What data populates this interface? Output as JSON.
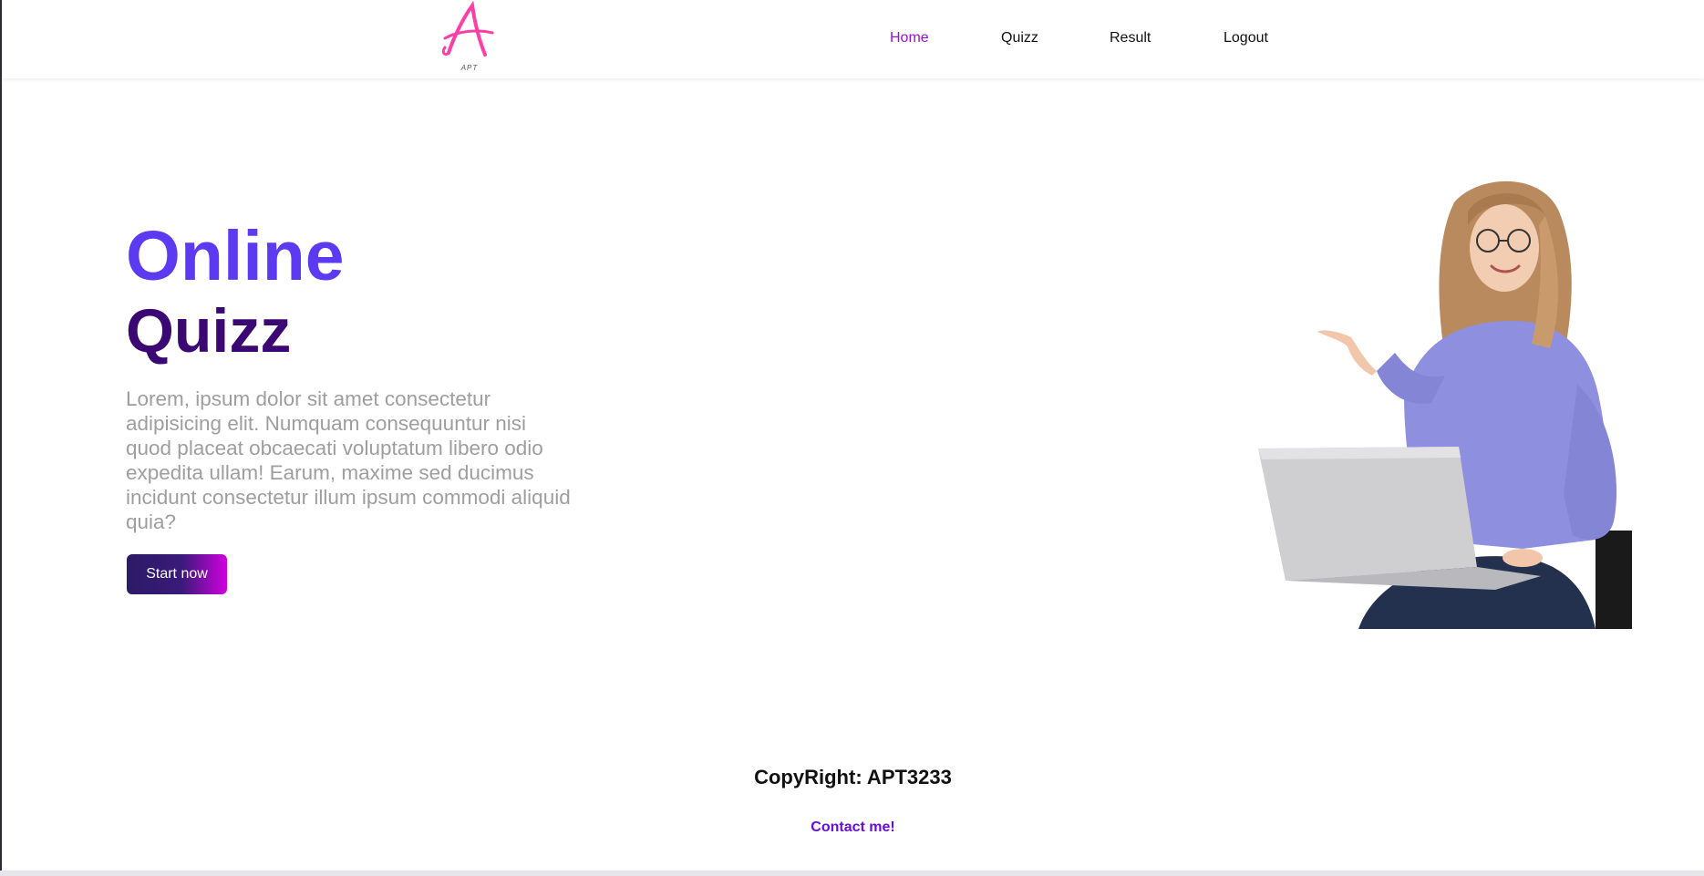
{
  "logo": {
    "text": "APT",
    "icon": "script-a-logo",
    "color": "#ff3fa8"
  },
  "nav": {
    "items": [
      {
        "label": "Home",
        "active": true
      },
      {
        "label": "Quizz",
        "active": false
      },
      {
        "label": "Result",
        "active": false
      },
      {
        "label": "Logout",
        "active": false
      }
    ],
    "active_color": "#9b11d8"
  },
  "hero": {
    "title_line1": "Online",
    "title_line2": "Quizz",
    "description": "Lorem, ipsum dolor sit amet consectetur adipisicing elit. Numquam consequuntur nisi quod placeat obcaecati voluptatum libero odio expedita ullam! Earum, maxime sed ducimus incidunt consectetur illum ipsum commodi aliquid quia?",
    "cta_label": "Start now",
    "image": "woman-with-laptop-pointing"
  },
  "footer": {
    "copyright": "CopyRight: APT3233",
    "contact_label": "Contact me!"
  },
  "colors": {
    "title_primary": "#5b3af2",
    "title_secondary": "#3b0772",
    "description": "#9e9e9e",
    "contact": "#6a0dd6"
  }
}
